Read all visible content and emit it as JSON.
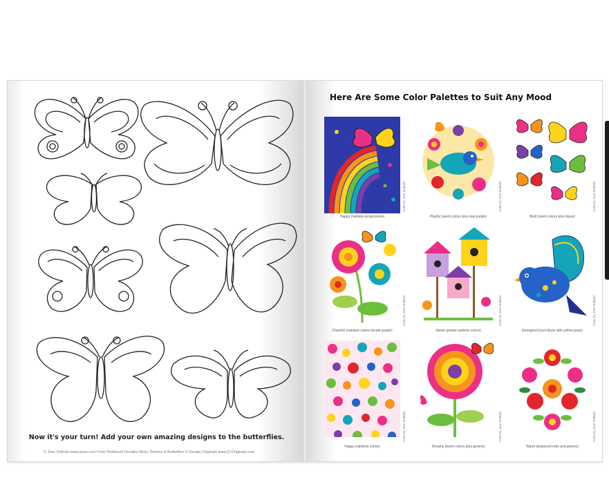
{
  "left_page": {
    "instruction": "Now it's your turn! Add your own amazing designs to the butterflies.",
    "credit": "© Jess Volinski  www.jessv.com  From Notebook Doodles Birds, Blooms & Butterflies © Design Originals  www.D-Originals.com"
  },
  "right_page": {
    "title": "Here Are Some Color Palettes to Suit Any Mood",
    "palettes": [
      {
        "caption": "Happy (rainbow progression)",
        "credit": "Color by Jess Volinski"
      },
      {
        "caption": "Playful (warm colors plus teal purple)",
        "credit": "Color by Jess Volinski"
      },
      {
        "caption": "Bold (warm colors plus blues)",
        "credit": "Color by Jess Volinski"
      },
      {
        "caption": "Cheerful (rainbow colors except purple)",
        "credit": "Color by Jess Volinski"
      },
      {
        "caption": "Sweet (pastel rainbow colors)",
        "credit": "Color by Jess Volinski"
      },
      {
        "caption": "Energized (cool blues with yellow pops)",
        "credit": "Color by Jess Volinski"
      },
      {
        "caption": "Happy (rainbow colors)",
        "credit": "Color by Jess Volinski"
      },
      {
        "caption": "Dreamy (warm colors plus greens)",
        "credit": "Color by Jess Volinski"
      },
      {
        "caption": "Warm (balanced reds and greens)",
        "credit": "Color by Jess Volinski"
      }
    ]
  },
  "colors": {
    "outline": "#222222",
    "pink": "#ec2f86",
    "orange": "#f7941d",
    "yellow": "#ffd31a",
    "green": "#6cbf3c",
    "teal": "#14a5b8",
    "blue": "#2563c9",
    "purple": "#7b3fa6",
    "red": "#e2262b",
    "navy": "#232f8f"
  }
}
